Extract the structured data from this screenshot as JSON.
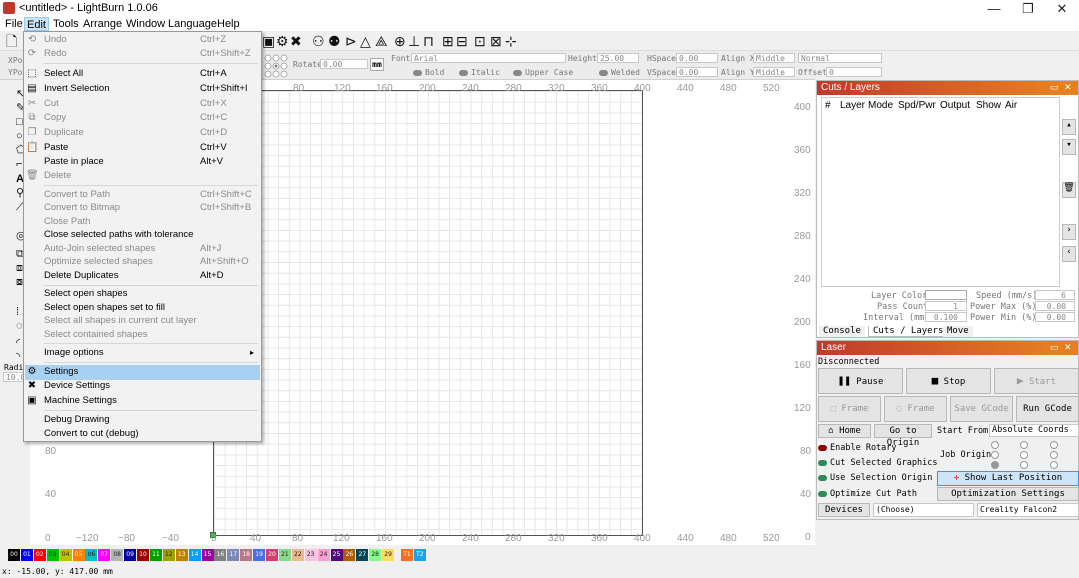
{
  "window": {
    "title": "<untitled> - LightBurn 1.0.06",
    "minimize": "—",
    "maximize": "❐",
    "close": "✕"
  },
  "menubar": [
    "File",
    "Edit",
    "Tools",
    "Arrange",
    "Window",
    "Language",
    "Help"
  ],
  "propbar": {
    "rotate_label": "Rotate",
    "rotate_value": "0.00",
    "units": "mm",
    "font_label": "Font",
    "font_value": "Arial",
    "height_label": "Height",
    "height_value": "25.00",
    "hspace_label": "HSpace",
    "hspace_value": "0.00",
    "vspace_label": "VSpace",
    "vspace_value": "0.00",
    "alignx_label": "Align X",
    "alignx_value": "Middle",
    "aligny_label": "Align Y",
    "aligny_value": "Middle",
    "mode_value": "Normal",
    "offset_label": "Offset",
    "offset_value": "0",
    "bold": "Bold",
    "italic": "Italic",
    "upper": "Upper Case",
    "welded": "Welded",
    "xpos": "XPos",
    "ypos": "YPos"
  },
  "edit_menu": {
    "items": [
      {
        "label": "Undo",
        "shortcut": "Ctrl+Z",
        "disabled": true
      },
      {
        "label": "Redo",
        "shortcut": "Ctrl+Shift+Z",
        "disabled": true
      },
      {
        "label": "Select All",
        "shortcut": "Ctrl+A"
      },
      {
        "label": "Invert Selection",
        "shortcut": "Ctrl+Shift+I"
      },
      {
        "label": "Cut",
        "shortcut": "Ctrl+X",
        "disabled": true
      },
      {
        "label": "Copy",
        "shortcut": "Ctrl+C",
        "disabled": true
      },
      {
        "label": "Duplicate",
        "shortcut": "Ctrl+D",
        "disabled": true
      },
      {
        "label": "Paste",
        "shortcut": "Ctrl+V"
      },
      {
        "label": "Paste in place",
        "shortcut": "Alt+V"
      },
      {
        "label": "Delete",
        "shortcut": "",
        "disabled": true
      },
      {
        "label": "Convert to Path",
        "shortcut": "Ctrl+Shift+C",
        "disabled": true
      },
      {
        "label": "Convert to Bitmap",
        "shortcut": "Ctrl+Shift+B",
        "disabled": true
      },
      {
        "label": "Close Path",
        "shortcut": "",
        "disabled": true
      },
      {
        "label": "Close selected paths with tolerance",
        "shortcut": ""
      },
      {
        "label": "Auto-Join selected shapes",
        "shortcut": "Alt+J",
        "disabled": true
      },
      {
        "label": "Optimize selected shapes",
        "shortcut": "Alt+Shift+O",
        "disabled": true
      },
      {
        "label": "Delete Duplicates",
        "shortcut": "Alt+D"
      },
      {
        "label": "Select open shapes",
        "shortcut": ""
      },
      {
        "label": "Select open shapes set to fill",
        "shortcut": ""
      },
      {
        "label": "Select all shapes in current cut layer",
        "shortcut": "",
        "disabled": true
      },
      {
        "label": "Select contained shapes",
        "shortcut": "",
        "disabled": true
      },
      {
        "label": "Image options",
        "shortcut": "▸"
      },
      {
        "label": "Settings",
        "shortcut": ""
      },
      {
        "label": "Device Settings",
        "shortcut": ""
      },
      {
        "label": "Machine Settings",
        "shortcut": ""
      },
      {
        "label": "Debug Drawing",
        "shortcut": ""
      },
      {
        "label": "Convert to cut (debug)",
        "shortcut": ""
      }
    ]
  },
  "rulers": {
    "top": [
      "80",
      "120",
      "160",
      "200",
      "240",
      "280",
      "320",
      "360",
      "400",
      "440",
      "480",
      "520"
    ],
    "bottom": [
      "0",
      "−120",
      "−80",
      "−40",
      "0",
      "40",
      "80",
      "120",
      "160",
      "200",
      "240",
      "280",
      "320",
      "360",
      "400",
      "440",
      "480",
      "520"
    ],
    "right": [
      "400",
      "360",
      "320",
      "280",
      "240",
      "200",
      "160",
      "120",
      "80",
      "40",
      "0"
    ],
    "left": [
      "80",
      "40"
    ]
  },
  "cuts_panel": {
    "title": "Cuts / Layers",
    "columns": [
      "#",
      "Layer",
      "Mode",
      "Spd/Pwr",
      "Output",
      "Show",
      "Air"
    ],
    "layer_color_label": "Layer Color",
    "speed_label": "Speed (mm/s)",
    "speed_value": "6",
    "pass_label": "Pass Count",
    "pass_value": "1",
    "powermax_label": "Power Max (%)",
    "powermax_value": "0.00",
    "interval_label": "Interval (mm)",
    "interval_value": "0.100",
    "powermin_label": "Power Min (%)",
    "powermin_value": "0.00",
    "tabs": [
      "Console",
      "Cuts / Layers",
      "Move"
    ]
  },
  "laser_panel": {
    "title": "Laser",
    "status": "Disconnected",
    "pause": "Pause",
    "stop": "Stop",
    "start": "Start",
    "frame1": "Frame",
    "frame2": "Frame",
    "save_gcode": "Save GCode",
    "run_gcode": "Run GCode",
    "home": "Home",
    "go_origin": "Go to Origin",
    "start_from_label": "Start From:",
    "start_from_value": "Absolute Coords",
    "enable_rotary": "Enable Rotary",
    "cut_selected": "Cut Selected Graphics",
    "use_selection_origin": "Use Selection Origin",
    "optimize_cut_path": "Optimize Cut Path",
    "job_origin": "Job Origin",
    "show_last_position": "Show Last Position",
    "optimization_settings": "Optimization Settings",
    "devices": "Devices",
    "choose": "(Choose)",
    "device_name": "Creality Falcon2"
  },
  "palette": [
    {
      "label": "00",
      "color": "#000000"
    },
    {
      "label": "01",
      "color": "#0000ff"
    },
    {
      "label": "02",
      "color": "#ff0000"
    },
    {
      "label": "03",
      "color": "#00c000"
    },
    {
      "label": "04",
      "color": "#c0c000"
    },
    {
      "label": "05",
      "color": "#ff8000"
    },
    {
      "label": "06",
      "color": "#00c0c0"
    },
    {
      "label": "07",
      "color": "#ff00ff"
    },
    {
      "label": "08",
      "color": "#b4b4b4"
    },
    {
      "label": "09",
      "color": "#0000a0"
    },
    {
      "label": "10",
      "color": "#a00000"
    },
    {
      "label": "11",
      "color": "#00a000"
    },
    {
      "label": "12",
      "color": "#a0a000"
    },
    {
      "label": "13",
      "color": "#c08000"
    },
    {
      "label": "14",
      "color": "#00a0ff"
    },
    {
      "label": "15",
      "color": "#a000a0"
    },
    {
      "label": "16",
      "color": "#808080"
    },
    {
      "label": "17",
      "color": "#7d87b9"
    },
    {
      "label": "18",
      "color": "#bb7784"
    },
    {
      "label": "19",
      "color": "#4a6fe3"
    },
    {
      "label": "20",
      "color": "#d33f6a"
    },
    {
      "label": "21",
      "color": "#8cd78c"
    },
    {
      "label": "22",
      "color": "#f0b98d"
    },
    {
      "label": "23",
      "color": "#f6c4e1"
    },
    {
      "label": "24",
      "color": "#fa9ed4"
    },
    {
      "label": "25",
      "color": "#500a78"
    },
    {
      "label": "26",
      "color": "#b45a00"
    },
    {
      "label": "27",
      "color": "#004754"
    },
    {
      "label": "28",
      "color": "#86fa88"
    },
    {
      "label": "29",
      "color": "#ffdb66"
    },
    {
      "label": "T1",
      "color": "#f37021"
    },
    {
      "label": "T2",
      "color": "#1aa3e8"
    }
  ],
  "status": {
    "coords": "x: -15.00, y: 417.00 mm"
  },
  "left_panel": {
    "radius_label": "Radi",
    "radius_value": "10.0"
  }
}
